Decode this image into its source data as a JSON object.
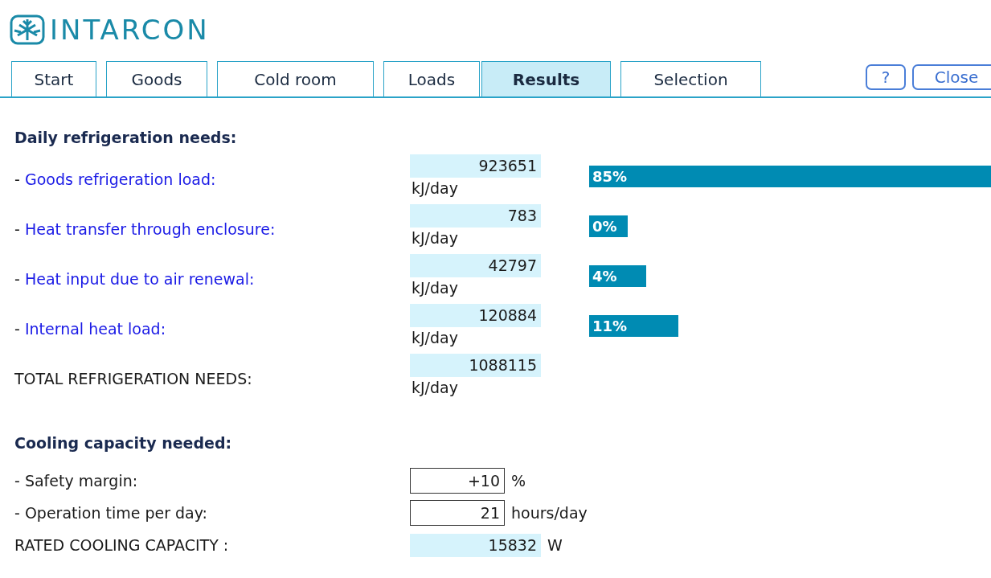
{
  "logo": {
    "text": "INTARCON"
  },
  "tabs": [
    {
      "label": "Start",
      "selected": false
    },
    {
      "label": "Goods",
      "selected": false
    },
    {
      "label": "Cold room",
      "selected": false
    },
    {
      "label": "Loads",
      "selected": false
    },
    {
      "label": "Results",
      "selected": true
    },
    {
      "label": "Selection",
      "selected": false
    }
  ],
  "buttons": [
    "?",
    "Close"
  ],
  "daily": {
    "heading": "Daily refrigeration needs:",
    "rows": [
      {
        "kind": "link",
        "dash": "-",
        "label": "Goods refrigeration load:",
        "value": "923651",
        "unit": "kJ/day",
        "percent": "85%"
      },
      {
        "kind": "link",
        "dash": "-",
        "label": "Heat transfer through enclosure:",
        "value": "783",
        "unit": "kJ/day",
        "percent": "0%"
      },
      {
        "kind": "link",
        "dash": "-",
        "label": "Heat input due to air renewal:",
        "value": "42797",
        "unit": "kJ/day",
        "percent": "4%"
      },
      {
        "kind": "link",
        "dash": "-",
        "label": "Internal heat load:",
        "value": "120884",
        "unit": "kJ/day",
        "percent": "11%"
      },
      {
        "kind": "total",
        "label": "TOTAL REFRIGERATION NEEDS:",
        "value": "1088115",
        "unit": "kJ/day"
      }
    ]
  },
  "cooling": {
    "heading": "Cooling capacity needed:",
    "rows": [
      {
        "kind": "input",
        "label": "- Safety margin:",
        "value": "+10",
        "unit": "%"
      },
      {
        "kind": "input",
        "label": "- Operation time per day:",
        "value": "21",
        "unit": "hours/day"
      },
      {
        "kind": "output",
        "label": "RATED COOLING CAPACITY :",
        "value": "15832",
        "unit": "W"
      }
    ]
  }
}
